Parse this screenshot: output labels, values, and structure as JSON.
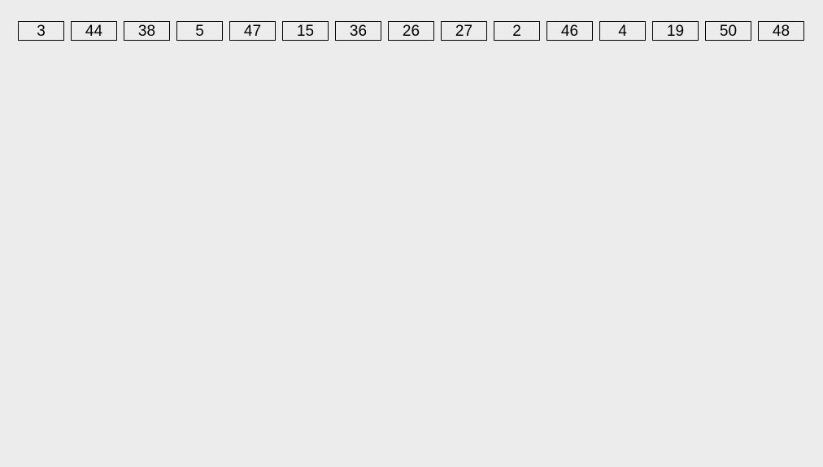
{
  "cells": [
    "3",
    "44",
    "38",
    "5",
    "47",
    "15",
    "36",
    "26",
    "27",
    "2",
    "46",
    "4",
    "19",
    "50",
    "48"
  ]
}
